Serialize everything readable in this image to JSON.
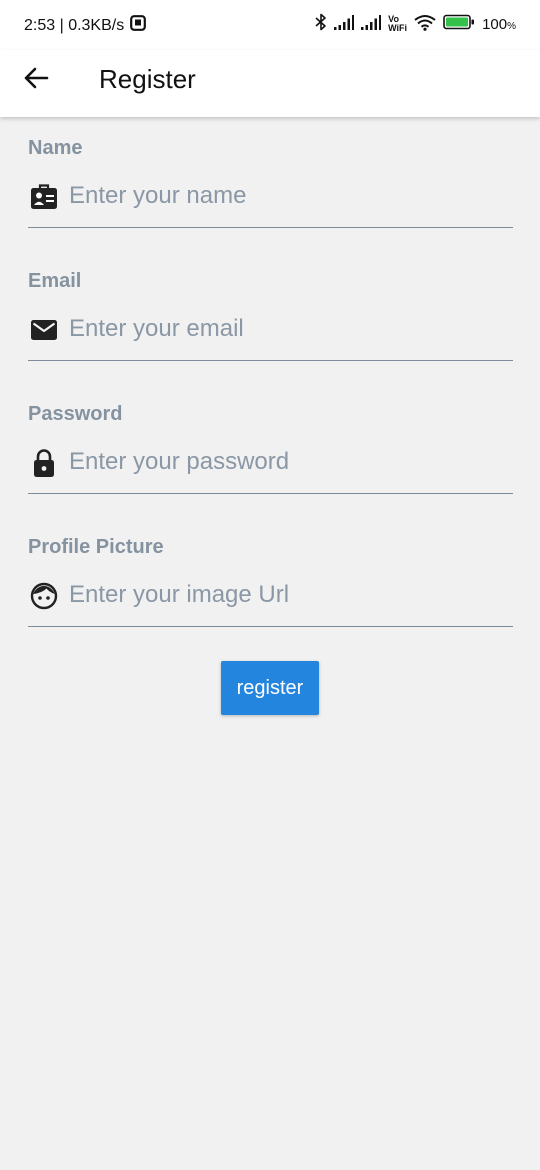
{
  "status_bar": {
    "time_speed": "2:53 | 0.3KB/s",
    "battery": "100",
    "battery_unit": "%",
    "volte_top": "Vo",
    "volte_bottom": "WiFi",
    "icons": [
      "notification-box-icon",
      "bluetooth-icon",
      "signal-icon",
      "signal-icon",
      "vowifi-icon",
      "wifi-icon",
      "battery-icon"
    ]
  },
  "app_bar": {
    "title": "Register",
    "back_icon": "arrow-left-icon"
  },
  "form": {
    "fields": [
      {
        "label": "Name",
        "placeholder": "Enter your name",
        "icon": "id-badge-icon"
      },
      {
        "label": "Email",
        "placeholder": "Enter your email",
        "icon": "mail-icon"
      },
      {
        "label": "Password",
        "placeholder": "Enter your password",
        "icon": "lock-icon"
      },
      {
        "label": "Profile Picture",
        "placeholder": "Enter your image Url",
        "icon": "face-icon"
      }
    ],
    "submit_label": "register"
  },
  "colors": {
    "accent": "#2385de",
    "label": "#8592a0",
    "background": "#f1f1f1",
    "battery": "#34c24b"
  }
}
